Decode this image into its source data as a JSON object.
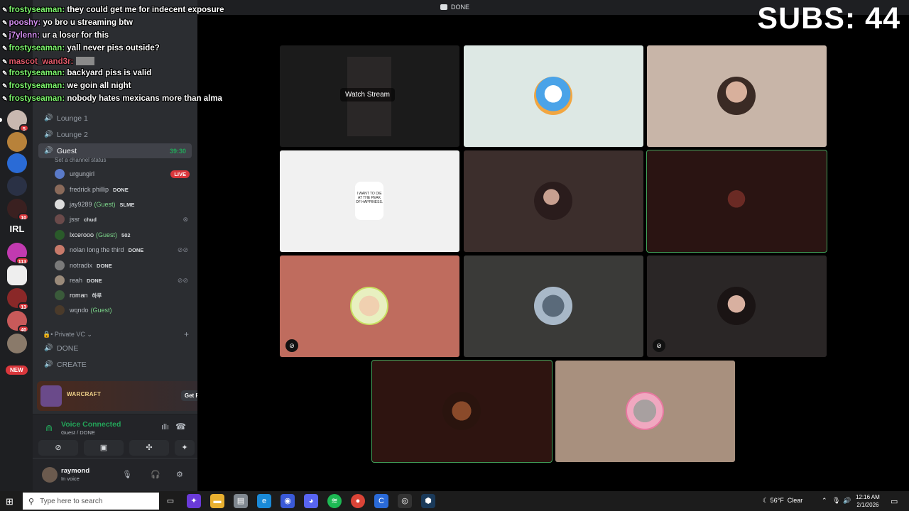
{
  "window": {
    "title": "DONE"
  },
  "subs_overlay": "SUBS: 44",
  "chat": [
    {
      "user": "frostyseaman:",
      "text": "they could get me for indecent exposure"
    },
    {
      "user": "pooshy:",
      "text": "yo bro u streaming btw"
    },
    {
      "user": "j7ylenn:",
      "text": "ur a loser for this"
    },
    {
      "user": "frostyseaman:",
      "text": "yall never piss outside?"
    },
    {
      "user": "mascot_wand3r:",
      "text": ""
    },
    {
      "user": "frostyseaman:",
      "text": "backyard piss is valid"
    },
    {
      "user": "frostyseaman:",
      "text": "we goin all night"
    },
    {
      "user": "frostyseaman:",
      "text": "nobody hates mexicans more than alma"
    }
  ],
  "rail_badges": [
    "5",
    "10",
    "113",
    "13",
    "40"
  ],
  "rail_text": "IRL",
  "rail_new": "NEW",
  "channels": {
    "lounge1": "Lounge 1",
    "lounge2": "Lounge 2",
    "guest": "Guest",
    "guest_time": "39:30",
    "guest_status": "Set a channel status",
    "private_category": "• Private VC",
    "done": "DONE",
    "create": "CREATE"
  },
  "members": [
    {
      "name": "urgungirl",
      "tag": "",
      "live": "LIVE"
    },
    {
      "name": "fredrick phillip",
      "tag": "DONE"
    },
    {
      "name": "jay9289",
      "guest": "(Guest)",
      "tag": "SLME"
    },
    {
      "name": "jssr",
      "tag": "chud"
    },
    {
      "name": "lxcerooo",
      "guest": "(Guest)",
      "tag": "502"
    },
    {
      "name": "nolan long the third",
      "tag": "DONE"
    },
    {
      "name": "notradix",
      "tag": "DONE"
    },
    {
      "name": "reah",
      "tag": "DONE"
    },
    {
      "name": "roman",
      "tag": "하루"
    },
    {
      "name": "wqndo",
      "guest": "(Guest)",
      "tag": ""
    }
  ],
  "promo": {
    "logo": "WARCRAFT",
    "button": "Get Reward!"
  },
  "voice": {
    "status": "Voice Connected",
    "location": "Guest / DONE"
  },
  "user": {
    "name": "raymond",
    "status": "In voice"
  },
  "stage": {
    "watch_stream": "Watch Stream",
    "tile_text": "I WANT TO DIE AT THE PEAK OF HAPPINESS."
  },
  "taskbar": {
    "search_placeholder": "Type here to search",
    "temp": "56°F",
    "weather": "Clear",
    "time": "12:16 AM",
    "date": "2/1/2026"
  },
  "colors": {
    "accent_green": "#23a559",
    "live_red": "#da373c",
    "chat_user": "#7cf56c"
  }
}
